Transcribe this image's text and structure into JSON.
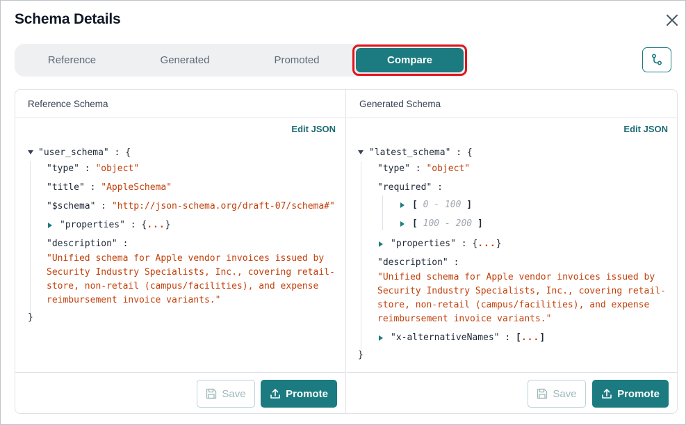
{
  "modal": {
    "title": "Schema Details"
  },
  "tabs": [
    {
      "label": "Reference"
    },
    {
      "label": "Generated"
    },
    {
      "label": "Promoted"
    },
    {
      "label": "Compare",
      "active": true
    }
  ],
  "left_panel": {
    "header": "Reference Schema",
    "edit_label": "Edit JSON",
    "root_key": "\"user_schema\"",
    "type_key": "\"type\"",
    "type_value": "\"object\"",
    "title_key": "\"title\"",
    "title_value": "\"AppleSchema\"",
    "schema_key": "\"$schema\"",
    "schema_value": "\"http://json-schema.org/draft-07/schema#\"",
    "properties_key": "\"properties\"",
    "collapsed": "...",
    "description_key": "\"description\"",
    "description_lines": [
      "\"Unified schema for Apple vendor invoices issued by",
      "Security Industry Specialists, Inc., covering retail-",
      "store, non-retail (campus/facilities), and expense",
      "reimbursement invoice variants.\""
    ],
    "save_label": "Save",
    "promote_label": "Promote"
  },
  "right_panel": {
    "header": "Generated Schema",
    "edit_label": "Edit JSON",
    "root_key": "\"latest_schema\"",
    "type_key": "\"type\"",
    "type_value": "\"object\"",
    "required_key": "\"required\"",
    "ranges": [
      "0 - 100",
      "100 - 200"
    ],
    "properties_key": "\"properties\"",
    "collapsed": "...",
    "description_key": "\"description\"",
    "description_lines": [
      "\"Unified schema for Apple vendor invoices issued by",
      "Security Industry Specialists, Inc., covering retail-",
      "store, non-retail (campus/facilities), and expense",
      "reimbursement invoice variants.\""
    ],
    "altnames_key": "\"x-alternativeNames\"",
    "save_label": "Save",
    "promote_label": "Promote"
  },
  "colors": {
    "accent": "#1b7b80",
    "string": "#c2410c",
    "highlight": "#e3131a"
  },
  "icons": [
    "close-icon",
    "git-branch-icon",
    "save-icon",
    "upload-icon",
    "expand-triangle-icon",
    "collapse-triangle-icon"
  ]
}
